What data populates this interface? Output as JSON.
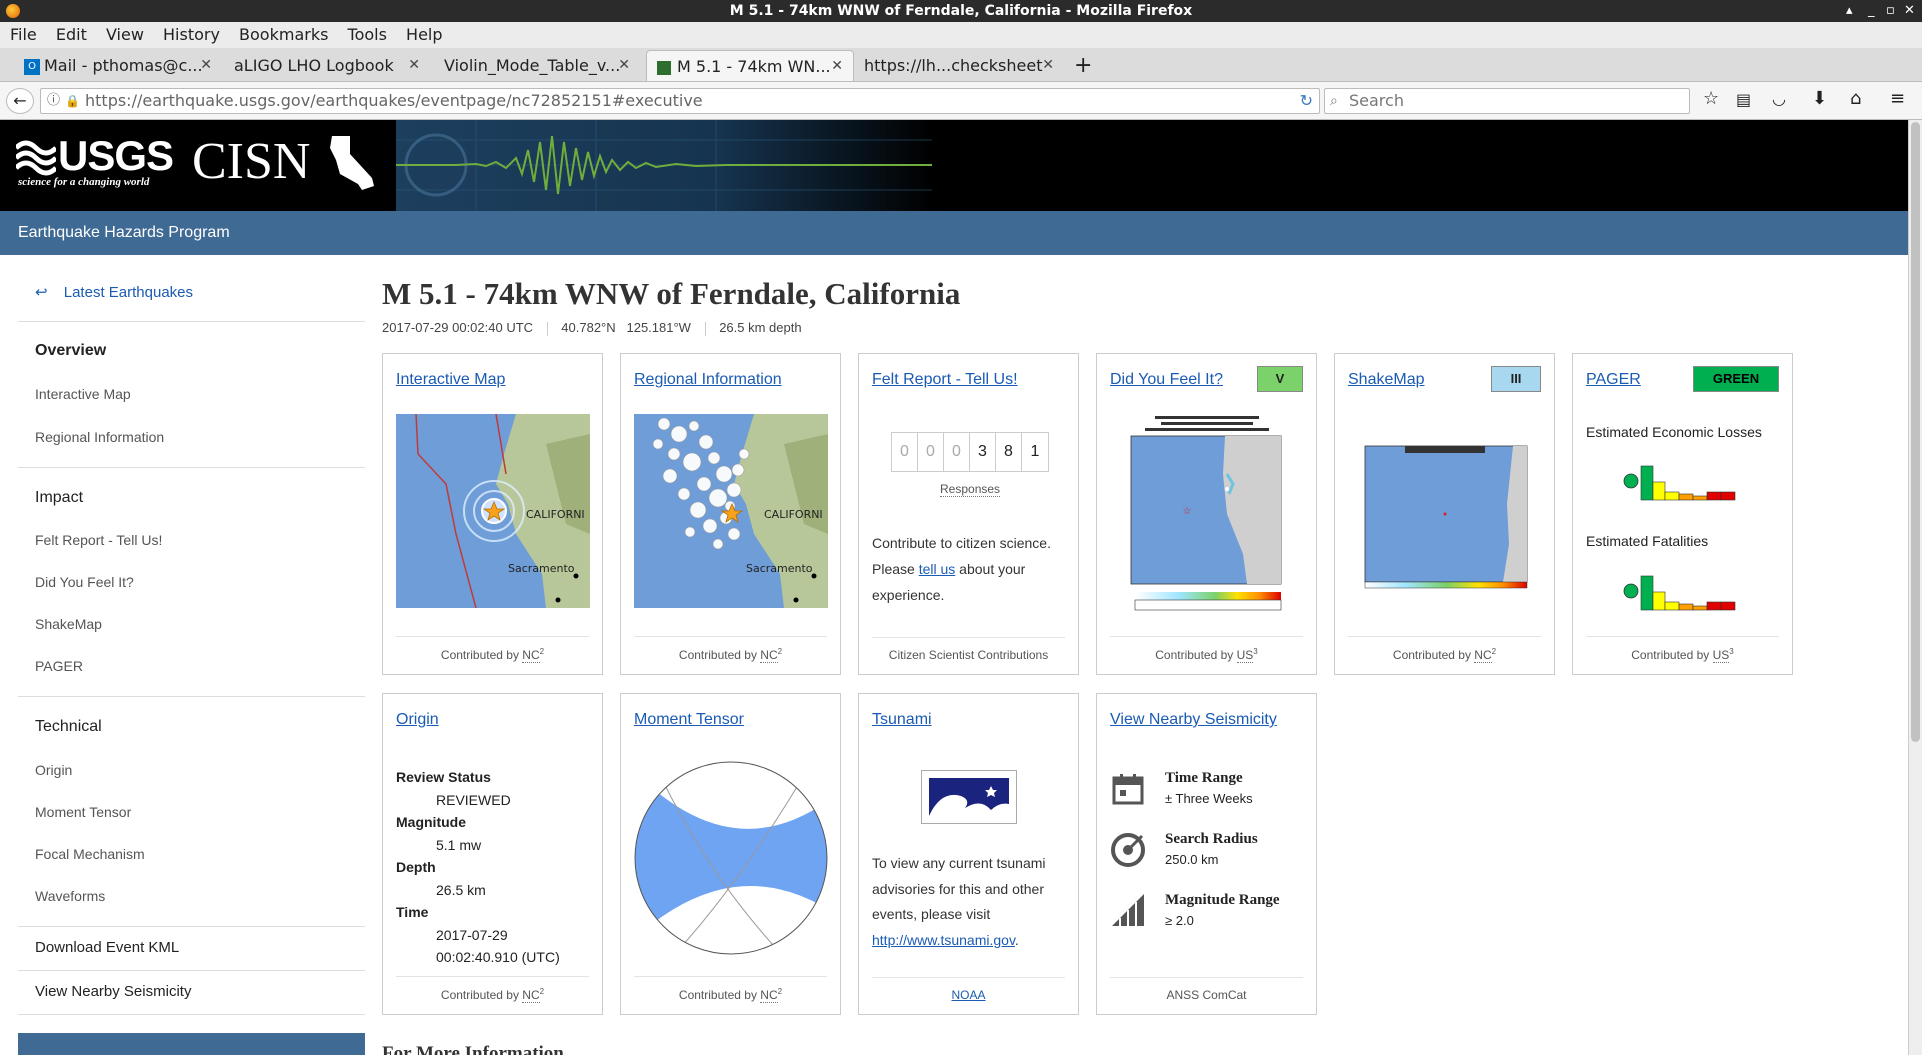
{
  "window": {
    "title": "M 5.1 - 74km WNW of Ferndale, California - Mozilla Firefox"
  },
  "menubar": [
    "File",
    "Edit",
    "View",
    "History",
    "Bookmarks",
    "Tools",
    "Help"
  ],
  "tabs": [
    {
      "label": "Mail - pthomas@c..."
    },
    {
      "label": "aLIGO LHO Logbook"
    },
    {
      "label": "Violin_Mode_Table_v..."
    },
    {
      "label": "M 5.1 - 74km WN..."
    },
    {
      "label": "https://lh...checksheet"
    }
  ],
  "navbar": {
    "url": "https://earthquake.usgs.gov/earthquakes/eventpage/nc72852151#executive",
    "search_placeholder": "Search"
  },
  "header": {
    "usgs": "USGS",
    "tagline": "science for a changing world",
    "cisn": "CISN"
  },
  "program": "Earthquake Hazards Program",
  "sidebar": {
    "back": "Latest Earthquakes",
    "overview": "Overview",
    "overview_items": [
      "Interactive Map",
      "Regional Information"
    ],
    "impact": "Impact",
    "impact_items": [
      "Felt Report - Tell Us!",
      "Did You Feel It?",
      "ShakeMap",
      "PAGER"
    ],
    "technical": "Technical",
    "technical_items": [
      "Origin",
      "Moment Tensor",
      "Focal Mechanism",
      "Waveforms"
    ],
    "download": "Download Event KML",
    "nearby": "View Nearby Seismicity"
  },
  "event": {
    "title": "M 5.1 - 74km WNW of Ferndale, California",
    "time": "2017-07-29 00:02:40 UTC",
    "location": "40.782°N   125.181°W",
    "depth": "26.5 km depth"
  },
  "cards": {
    "interactive_map": {
      "title": "Interactive Map",
      "contrib": "Contributed by",
      "net": "NC",
      "sup": "2",
      "map_label_state": "CALIFORNI",
      "map_label_city": "Sacramento"
    },
    "regional": {
      "title": "Regional Information",
      "contrib": "Contributed by",
      "net": "NC",
      "sup": "2",
      "map_label_state": "CALIFORNI",
      "map_label_city": "Sacramento"
    },
    "felt": {
      "title": "Felt Report - Tell Us!",
      "digits": [
        "0",
        "0",
        "0",
        "3",
        "8",
        "1"
      ],
      "responses": "Responses",
      "text1": "Contribute to citizen science. Please ",
      "link": "tell us",
      "text2": " about your experience.",
      "footer": "Citizen Scientist Contributions"
    },
    "dyfi": {
      "title": "Did You Feel It?",
      "badge": "V",
      "contrib": "Contributed by",
      "net": "US",
      "sup": "3"
    },
    "shakemap": {
      "title": "ShakeMap",
      "badge": "III",
      "contrib": "Contributed by",
      "net": "NC",
      "sup": "2"
    },
    "pager": {
      "title": "PAGER",
      "badge": "GREEN",
      "losses": "Estimated Economic Losses",
      "fatalities": "Estimated Fatalities",
      "contrib": "Contributed by",
      "net": "US",
      "sup": "3"
    },
    "origin": {
      "title": "Origin",
      "rows": [
        {
          "label": "Review Status",
          "value": "REVIEWED"
        },
        {
          "label": "Magnitude",
          "value": "5.1 mw"
        },
        {
          "label": "Depth",
          "value": "26.5 km"
        },
        {
          "label": "Time",
          "value": "2017-07-29",
          "value2": "00:02:40.910 (UTC)"
        }
      ],
      "contrib": "Contributed by",
      "net": "NC",
      "sup": "2"
    },
    "moment_tensor": {
      "title": "Moment Tensor",
      "contrib": "Contributed by",
      "net": "NC",
      "sup": "2"
    },
    "tsunami": {
      "title": "Tsunami",
      "text": "To view any current tsunami advisories for this and other events, please visit ",
      "link": "http://www.tsunami.gov",
      "period": ".",
      "footer": "NOAA"
    },
    "nearby": {
      "title": "View Nearby Seismicity",
      "rows": [
        {
          "label": "Time Range",
          "value": "± Three Weeks"
        },
        {
          "label": "Search Radius",
          "value": "250.0 km"
        },
        {
          "label": "Magnitude Range",
          "value": "≥ 2.0"
        }
      ],
      "footer": "ANSS ComCat"
    }
  },
  "more_info": "For More Information",
  "colors": {
    "link": "#1a5bb3",
    "header": "#3e6a94",
    "dyfi_v": "#7bd16a",
    "shake_iii": "#a8d8f0",
    "pager_green": "#00b050"
  }
}
